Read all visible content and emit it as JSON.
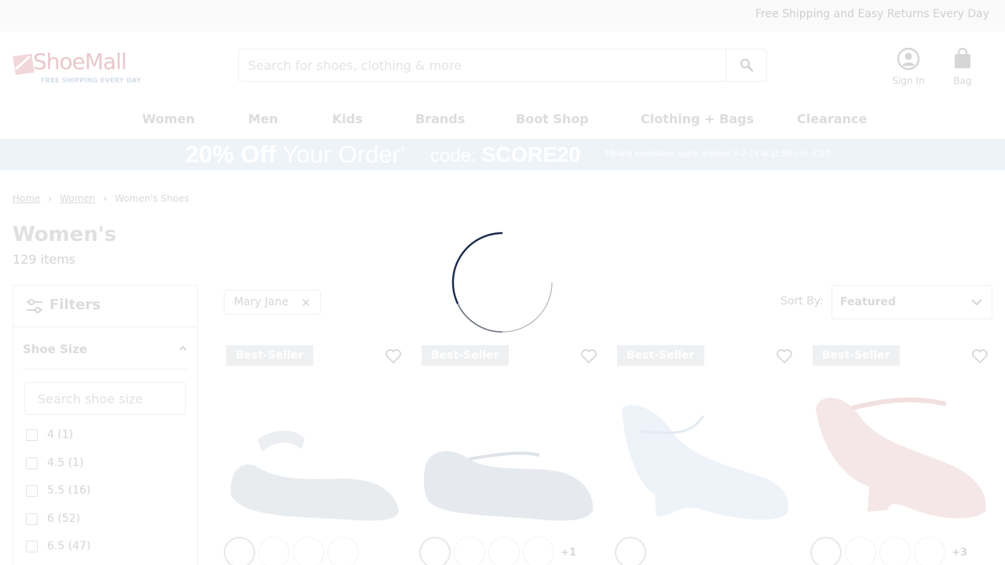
{
  "topbar": {
    "text": "Free Shipping and Easy Returns Every Day"
  },
  "brand": {
    "name": "ShoeMall",
    "tagline": "FREE SHIPPING EVERY DAY",
    "logo_icon": "shoemall-logo"
  },
  "search": {
    "placeholder": "Search for shoes, clothing & more",
    "value": "",
    "icon": "search-icon"
  },
  "account": {
    "sign_in_label": "Sign In",
    "bag_label": "Bag"
  },
  "nav": {
    "items": [
      "Women",
      "Men",
      "Kids",
      "Brands",
      "Boot Shop",
      "Clothing + Bags",
      "Clearance"
    ]
  },
  "promo": {
    "headline_bold": "20% Off",
    "headline_rest": "Your Order",
    "mark": "†",
    "code_label": "code:",
    "code": "SCORE20",
    "fine_print": "†Brand exclusions apply. Expires 6-2-24 at 11:59 p.m. CST."
  },
  "breadcrumb": {
    "items": [
      "Home",
      "Women",
      "Women's Shoes"
    ]
  },
  "page": {
    "title": "Women's",
    "count": "129 items"
  },
  "filters": {
    "title": "Filters",
    "shoe_size": {
      "heading": "Shoe Size",
      "search_placeholder": "Search shoe size",
      "options": [
        "4 (1)",
        "4.5 (1)",
        "5.5 (16)",
        "6 (52)",
        "6.5 (47)"
      ]
    }
  },
  "active_filter": {
    "label": "Mary Jane"
  },
  "sort": {
    "label": "Sort By:",
    "value": "Featured"
  },
  "products": [
    {
      "badge": "Best-Seller",
      "color": "#e9ecef",
      "swatch_count": 4,
      "more": ""
    },
    {
      "badge": "Best-Seller",
      "color": "#e6e9ee",
      "swatch_count": 4,
      "more": "+1"
    },
    {
      "badge": "Best-Seller",
      "color": "#eef2f9",
      "swatch_count": 1,
      "more": ""
    },
    {
      "badge": "Best-Seller",
      "color": "#f5e7e7",
      "swatch_count": 4,
      "more": "+3"
    }
  ],
  "state": {
    "loading": true
  },
  "colors": {
    "accent": "#1b2a4a",
    "promo_bg": "#eef3f8"
  }
}
